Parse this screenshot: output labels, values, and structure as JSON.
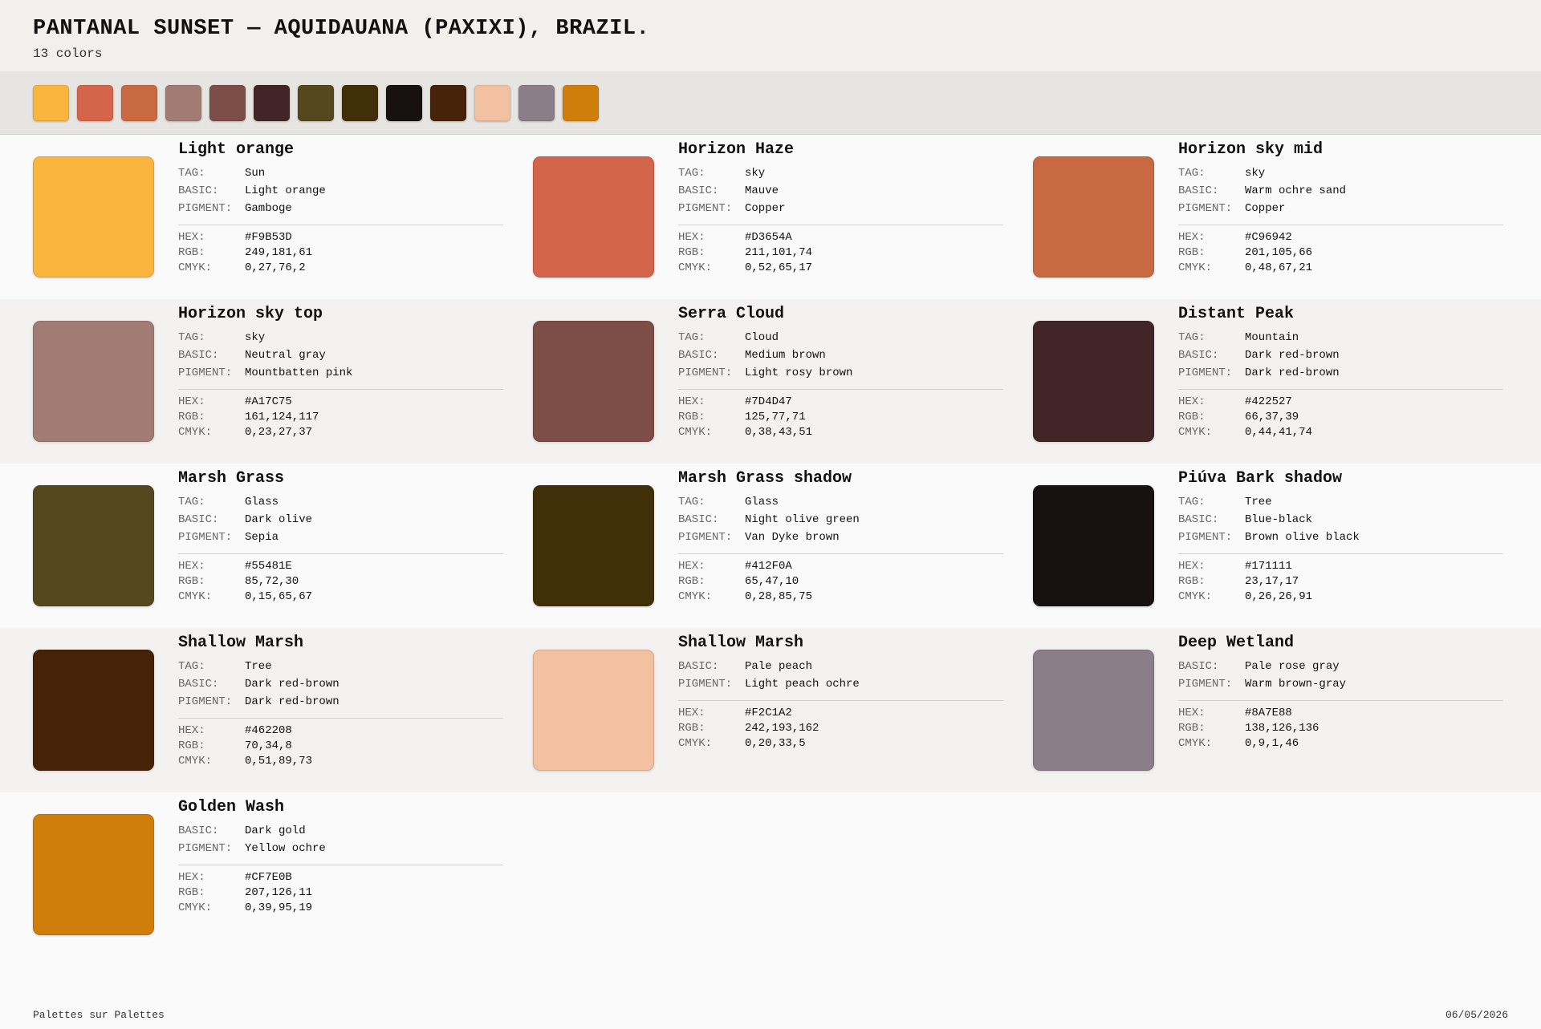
{
  "header": {
    "title": "PANTANAL SUNSET — AQUIDAUANA (PAXIXI), BRAZIL.",
    "count": "13 colors"
  },
  "labels": {
    "tag": "TAG:",
    "basic": "BASIC:",
    "pigment": "PIGMENT:",
    "hex": "HEX:",
    "rgb": "RGB:",
    "cmyk": "CMYK:"
  },
  "colors": [
    {
      "name": "Light orange",
      "tag": "Sun",
      "basic": "Light orange",
      "pigment": "Gamboge",
      "hex": "#F9B53D",
      "rgb": "249,181,61",
      "cmyk": "0,27,76,2"
    },
    {
      "name": "Horizon Haze",
      "tag": "sky",
      "basic": "Mauve",
      "pigment": "Copper",
      "hex": "#D3654A",
      "rgb": "211,101,74",
      "cmyk": "0,52,65,17"
    },
    {
      "name": "Horizon sky mid",
      "tag": "sky",
      "basic": "Warm ochre sand",
      "pigment": "Copper",
      "hex": "#C96942",
      "rgb": "201,105,66",
      "cmyk": "0,48,67,21"
    },
    {
      "name": "Horizon sky top",
      "tag": "sky",
      "basic": "Neutral gray",
      "pigment": "Mountbatten pink",
      "hex": "#A17C75",
      "rgb": "161,124,117",
      "cmyk": "0,23,27,37"
    },
    {
      "name": "Serra Cloud",
      "tag": "Cloud",
      "basic": "Medium brown",
      "pigment": "Light rosy brown",
      "hex": "#7D4D47",
      "rgb": "125,77,71",
      "cmyk": "0,38,43,51"
    },
    {
      "name": "Distant Peak",
      "tag": "Mountain",
      "basic": "Dark red-brown",
      "pigment": "Dark red-brown",
      "hex": "#422527",
      "rgb": "66,37,39",
      "cmyk": "0,44,41,74"
    },
    {
      "name": "Marsh Grass",
      "tag": "Glass",
      "basic": "Dark olive",
      "pigment": "Sepia",
      "hex": "#55481E",
      "rgb": "85,72,30",
      "cmyk": "0,15,65,67"
    },
    {
      "name": "Marsh Grass shadow",
      "tag": "Glass",
      "basic": "Night olive green",
      "pigment": "Van Dyke brown",
      "hex": "#412F0A",
      "rgb": "65,47,10",
      "cmyk": "0,28,85,75"
    },
    {
      "name": "Piúva Bark shadow",
      "tag": "Tree",
      "basic": "Blue-black",
      "pigment": "Brown olive black",
      "hex": "#171111",
      "rgb": "23,17,17",
      "cmyk": "0,26,26,91"
    },
    {
      "name": "Shallow Marsh",
      "tag": "Tree",
      "basic": "Dark red-brown",
      "pigment": "Dark red-brown",
      "hex": "#462208",
      "rgb": "70,34,8",
      "cmyk": "0,51,89,73"
    },
    {
      "name": "Shallow Marsh",
      "basic": "Pale peach",
      "pigment": "Light peach ochre",
      "hex": "#F2C1A2",
      "rgb": "242,193,162",
      "cmyk": "0,20,33,5"
    },
    {
      "name": "Deep Wetland",
      "basic": "Pale rose gray",
      "pigment": "Warm brown-gray",
      "hex": "#8A7E88",
      "rgb": "138,126,136",
      "cmyk": "0,9,1,46"
    },
    {
      "name": "Golden Wash",
      "basic": "Dark gold",
      "pigment": "Yellow ochre",
      "hex": "#CF7E0B",
      "rgb": "207,126,11",
      "cmyk": "0,39,95,19"
    }
  ],
  "footer": {
    "left": "Palettes sur Palettes",
    "right": "06/05/2026"
  }
}
